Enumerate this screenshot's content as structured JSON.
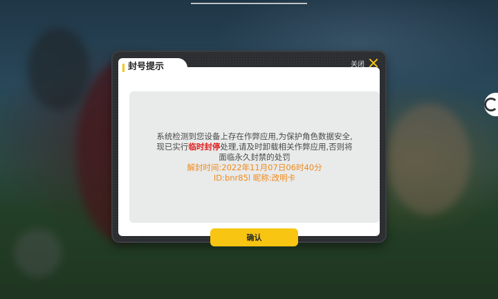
{
  "dialog": {
    "title": "封号提示",
    "close_label": "关闭",
    "message": {
      "line1": "系统检测到您设备上存在作弊应用,为保护角色数据安全,",
      "line2_prefix": "现已实行",
      "line2_highlight": "临时封停",
      "line2_suffix": "处理,请及时卸载相关作弊应用,否则将",
      "line3": "面临永久封禁的处罚",
      "unban_time": "解封时间:2022年11月07日06时40分",
      "account_info": "ID:bnr85l 昵称:改明卡"
    },
    "confirm_label": "确认"
  },
  "colors": {
    "accent": "#f7c512",
    "highlight": "#e02222",
    "info": "#f08a1a"
  }
}
